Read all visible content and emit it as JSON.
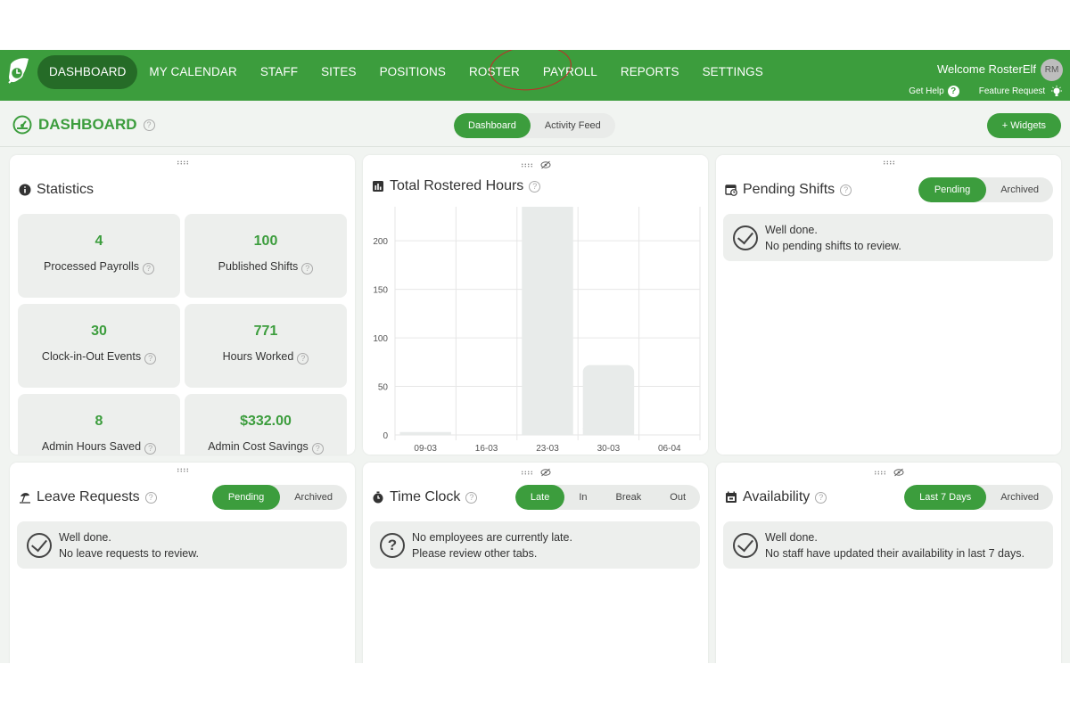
{
  "nav": {
    "items": [
      "DASHBOARD",
      "MY CALENDAR",
      "STAFF",
      "SITES",
      "POSITIONS",
      "ROSTER",
      "PAYROLL",
      "REPORTS",
      "SETTINGS"
    ],
    "welcome": "Welcome RosterElf",
    "avatar": "RM",
    "get_help": "Get Help",
    "feature_request": "Feature Request"
  },
  "header": {
    "title": "DASHBOARD",
    "help": "?",
    "tabs": [
      "Dashboard",
      "Activity Feed"
    ],
    "widgets_button": "+ Widgets"
  },
  "statistics": {
    "title": "Statistics",
    "tiles": [
      {
        "value": "4",
        "label": "Processed Payrolls"
      },
      {
        "value": "100",
        "label": "Published Shifts"
      },
      {
        "value": "30",
        "label": "Clock-in-Out Events"
      },
      {
        "value": "771",
        "label": "Hours Worked"
      },
      {
        "value": "8",
        "label": "Admin Hours Saved"
      },
      {
        "value": "$332.00",
        "label": "Admin Cost Savings"
      }
    ]
  },
  "rostered_hours": {
    "title": "Total Rostered Hours"
  },
  "chart_data": {
    "type": "bar",
    "title": "Total Rostered Hours",
    "categories": [
      "09-03",
      "16-03",
      "23-03",
      "30-03",
      "06-04"
    ],
    "values": [
      3,
      0,
      240,
      72,
      0
    ],
    "yticks": [
      0,
      50,
      100,
      150,
      200
    ],
    "ylim": [
      0,
      235
    ],
    "grid": true
  },
  "pending_shifts": {
    "title": "Pending Shifts",
    "tabs": [
      "Pending",
      "Archived"
    ],
    "line1": "Well done.",
    "line2": "No pending shifts to review."
  },
  "leave_requests": {
    "title": "Leave Requests",
    "tabs": [
      "Pending",
      "Archived"
    ],
    "line1": "Well done.",
    "line2": "No leave requests to review."
  },
  "time_clock": {
    "title": "Time Clock",
    "tabs": [
      "Late",
      "In",
      "Break",
      "Out"
    ],
    "line1": "No employees are currently late.",
    "line2": "Please review other tabs."
  },
  "availability": {
    "title": "Availability",
    "tabs": [
      "Last 7 Days",
      "Archived"
    ],
    "line1": "Well done.",
    "line2": "No staff have updated their availability in last 7 days."
  },
  "colors": {
    "brand": "#3c9d3d",
    "brand_dark": "#256b27"
  }
}
